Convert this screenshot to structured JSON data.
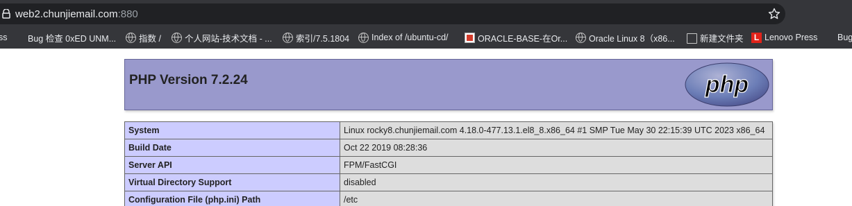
{
  "browser": {
    "url_host": "web2.chunjiemail.com",
    "url_port": ":880",
    "bookmarks": [
      {
        "label": "ss",
        "icon": "none"
      },
      {
        "label": "Bug 检查 0xED UNM...",
        "icon": "microsoft-icon"
      },
      {
        "label": "指数 /",
        "icon": "globe-icon"
      },
      {
        "label": "个人网站-技术文档 - ...",
        "icon": "globe-icon"
      },
      {
        "label": "索引/7.5.1804",
        "icon": "globe-icon"
      },
      {
        "label": "Index of /ubuntu-cd/",
        "icon": "globe-icon"
      },
      {
        "label": "ORACLE-BASE-在Or...",
        "icon": "oracle-icon"
      },
      {
        "label": "Oracle Linux 8（x86...",
        "icon": "globe-icon"
      },
      {
        "label": "新建文件夹",
        "icon": "folder-icon"
      },
      {
        "label": "Lenovo Press",
        "icon": "lenovo-icon"
      },
      {
        "label": "Bug",
        "icon": "microsoft-icon"
      }
    ]
  },
  "php": {
    "title": "PHP Version 7.2.24",
    "logo_text": "php",
    "rows": [
      {
        "key": "System",
        "value": "Linux rocky8.chunjiemail.com 4.18.0-477.13.1.el8_8.x86_64 #1 SMP Tue May 30 22:15:39 UTC 2023 x86_64"
      },
      {
        "key": "Build Date",
        "value": "Oct 22 2019 08:28:36"
      },
      {
        "key": "Server API",
        "value": "FPM/FastCGI"
      },
      {
        "key": "Virtual Directory Support",
        "value": "disabled"
      },
      {
        "key": "Configuration File (php.ini) Path",
        "value": "/etc"
      }
    ]
  },
  "colors": {
    "header_bg": "#9999cc",
    "key_bg": "#ccccff",
    "value_bg": "#dddddd",
    "chrome_bg": "#35363a"
  }
}
